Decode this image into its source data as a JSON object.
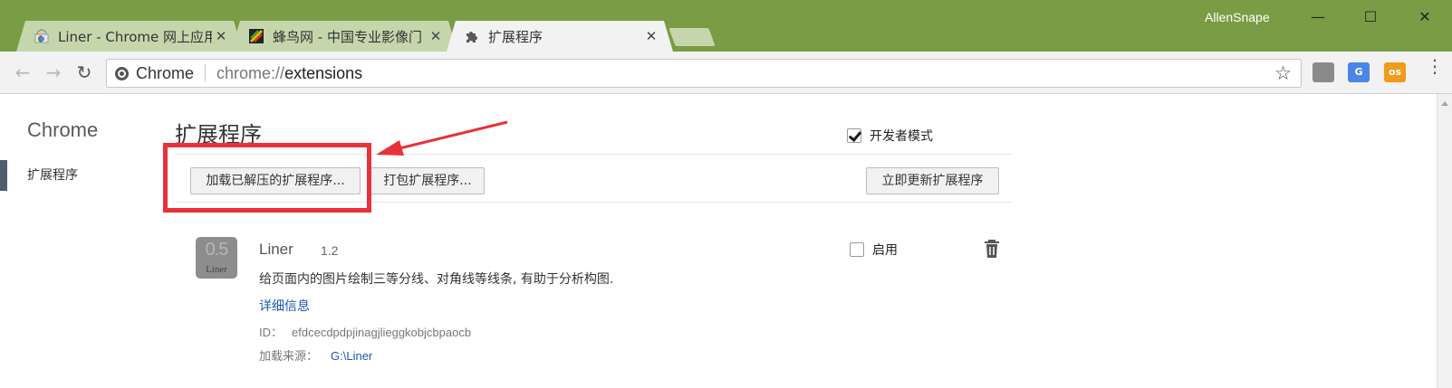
{
  "window": {
    "profile_name": "AllenSnape",
    "minimize": "—",
    "maximize": "☐",
    "close": "✕"
  },
  "tabs": [
    {
      "title": "Liner - Chrome 网上应用",
      "close": "✕",
      "active": false
    },
    {
      "title": "蜂鸟网 - 中国专业影像门",
      "close": "✕",
      "active": false
    },
    {
      "title": "扩展程序",
      "close": "✕",
      "active": true
    }
  ],
  "toolbar": {
    "back": "←",
    "forward": "→",
    "reload": "↻",
    "omnibox_label": "Chrome",
    "url_scheme": "chrome://",
    "url_host": "extensions",
    "star": "☆",
    "extensions": [
      {
        "icon": "page-icon",
        "text": "",
        "color": "#8a8a8a"
      },
      {
        "icon": "translate-icon",
        "text": "G",
        "color": "#4a86e8"
      },
      {
        "icon": "liner-icon",
        "text": "os",
        "color": "#f29a1a"
      }
    ],
    "menu": "⋮"
  },
  "sidebar": {
    "title": "Chrome",
    "items": [
      {
        "label": "扩展程序",
        "selected": true
      }
    ]
  },
  "main": {
    "title": "扩展程序",
    "developer_mode": {
      "label": "开发者模式",
      "checked": true
    },
    "buttons": {
      "load_unpacked": "加载已解压的扩展程序...",
      "pack": "打包扩展程序...",
      "update": "立即更新扩展程序"
    }
  },
  "extension": {
    "icon_big": "0.5",
    "icon_small": "Liner",
    "name": "Liner",
    "version": "1.2",
    "description": "给页面内的图片绘制三等分线、对角线等线条, 有助于分析构图.",
    "details_link": "详细信息",
    "id_label": "ID：",
    "id_value": "efdcecdpdpjinagjlieggkobjcbpaocb",
    "source_label": "加载来源：",
    "source_value": "G:\\Liner",
    "enable_label": "启用",
    "enabled": false
  },
  "colors": {
    "frame": "#7a9c45",
    "inactive_tab": "#c5d6ac",
    "highlight": "#e8323a",
    "link": "#1a56b8"
  }
}
